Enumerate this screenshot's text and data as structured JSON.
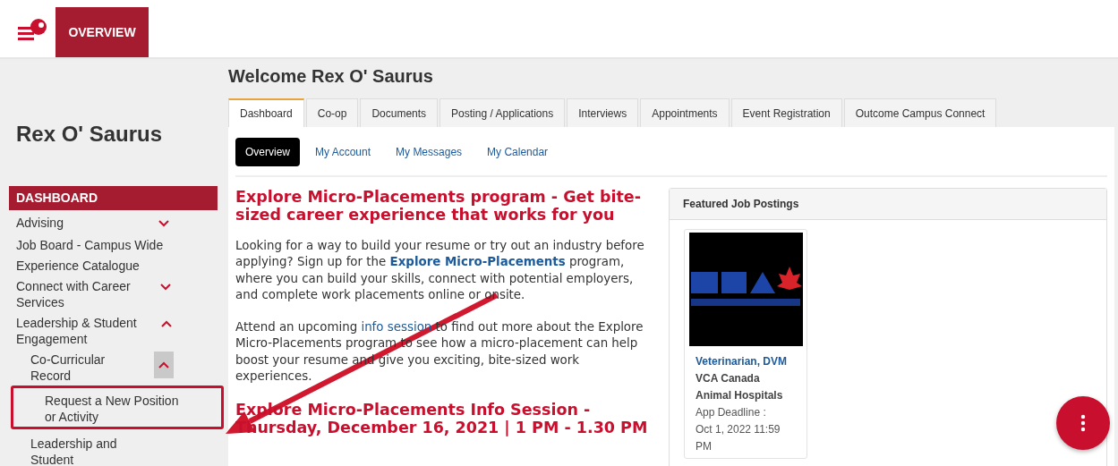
{
  "header": {
    "nav_tab": "OVERVIEW"
  },
  "sidebar": {
    "user_name": "Rex O' Saurus",
    "section": "DASHBOARD",
    "items": [
      {
        "label": "Advising",
        "expanded": false
      },
      {
        "label": "Job Board - Campus Wide"
      },
      {
        "label": "Experience Catalogue"
      },
      {
        "label": "Connect with Career Services",
        "expanded": false
      },
      {
        "label": "Leadership & Student Engagement",
        "expanded": true,
        "children": [
          {
            "label": "Co-Curricular Record",
            "expanded": true,
            "children": [
              {
                "label": "Request a New Position or Activity",
                "highlighted": true
              }
            ]
          },
          {
            "label": "Leadership and Student"
          }
        ]
      }
    ]
  },
  "welcome": "Welcome Rex O' Saurus",
  "tabs": [
    {
      "label": "Dashboard",
      "selected": true
    },
    {
      "label": "Co-op",
      "selected": false
    },
    {
      "label": "Documents",
      "selected": false
    },
    {
      "label": "Posting / Applications",
      "selected": false
    },
    {
      "label": "Interviews",
      "selected": false
    },
    {
      "label": "Appointments",
      "selected": false
    },
    {
      "label": "Event Registration",
      "selected": false
    },
    {
      "label": "Outcome Campus Connect",
      "selected": false
    }
  ],
  "subtabs": [
    {
      "label": "Overview",
      "selected": true
    },
    {
      "label": "My Account",
      "selected": false
    },
    {
      "label": "My Messages",
      "selected": false
    },
    {
      "label": "My Calendar",
      "selected": false
    }
  ],
  "articles": [
    {
      "heading": "Explore Micro-Placements program - Get bite-sized career experience that works for you",
      "paragraphs": [
        [
          {
            "text": "Looking for a way to build your resume or try out an industry before applying? Sign up for the "
          },
          {
            "text": "Explore Micro-Placements",
            "kind": "link",
            "bold": true
          },
          {
            "text": " program, where you can build your skills, connect with potential employers, and complete work placements online or onsite."
          }
        ],
        [
          {
            "text": "Attend an upcoming "
          },
          {
            "text": "info session",
            "kind": "link",
            "bold": false
          },
          {
            "text": " to find out more about the Explore Micro-Placements program to see how a micro-placement can help boost your resume and give you exciting, bite-sized work experiences."
          }
        ]
      ]
    },
    {
      "heading": "Explore Micro-Placements Info Session - Thursday, December 16, 2021 | 1 PM - 1.30 PM"
    }
  ],
  "featured": {
    "title": "Featured Job Postings",
    "postings": [
      {
        "job_title": "Veterinarian, DVM",
        "company": "VCA Canada Animal Hospitals",
        "deadline_label": "App Deadline :",
        "deadline": "Oct 1, 2022 11:59 PM"
      }
    ]
  }
}
